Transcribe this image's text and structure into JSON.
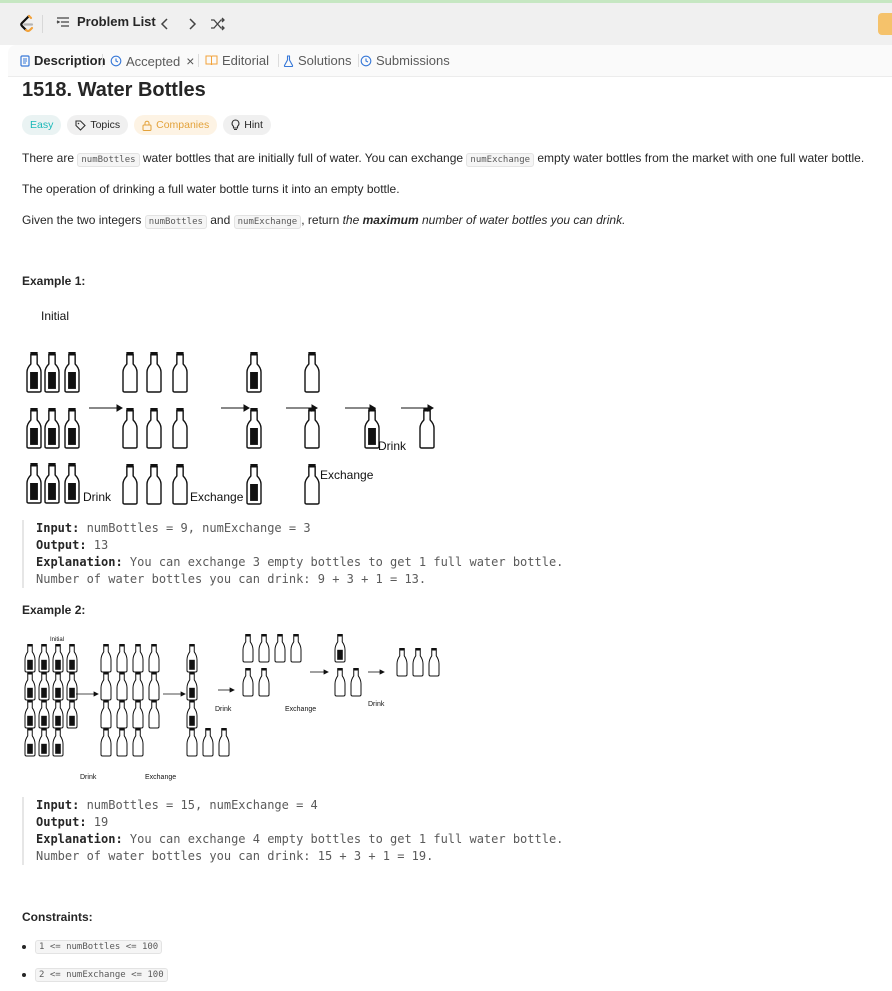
{
  "topbar": {
    "problem_list_label": "Problem List",
    "prev_icon": "chevron-left",
    "next_icon": "chevron-right",
    "shuffle_icon": "shuffle"
  },
  "tabs": [
    {
      "label": "Description",
      "icon": "document-icon"
    },
    {
      "label": "Accepted",
      "icon": "history-icon"
    },
    {
      "label": "Editorial",
      "icon": "book-icon"
    },
    {
      "label": "Solutions",
      "icon": "flask-icon"
    },
    {
      "label": "Submissions",
      "icon": "history-icon"
    }
  ],
  "problem": {
    "title": "1518. Water Bottles",
    "difficulty": "Easy",
    "tags": {
      "topics": "Topics",
      "companies": "Companies",
      "hint": "Hint"
    },
    "desc1": {
      "a": "There are ",
      "code1": "numBottles",
      "b": " water bottles that are initially full of water. You can exchange ",
      "code2": "numExchange",
      "c": " empty water bottles from the market with one full water bottle."
    },
    "desc2": "The operation of drinking a full water bottle turns it into an empty bottle.",
    "desc3": {
      "a": "Given the two integers ",
      "code1": "numBottles",
      "b": " and ",
      "code2": "numExchange",
      "c": ", return ",
      "d": "the ",
      "e": "maximum",
      "f": " number of water bottles you can drink."
    }
  },
  "example1": {
    "heading": "Example 1:",
    "fig": {
      "initial": "Initial",
      "drink1": "Drink",
      "exchange1": "Exchange",
      "exchange2": "Exchange",
      "drink2": "Drink"
    },
    "input_label": "Input:",
    "input": " numBottles = 9, numExchange = 3",
    "output_label": "Output:",
    "output": " 13",
    "expl_label": "Explanation:",
    "expl": " You can exchange 3 empty bottles to get 1 full water bottle.",
    "expl2": "Number of water bottles you can drink: 9 + 3 + 1 = 13."
  },
  "example2": {
    "heading": "Example 2:",
    "fig": {
      "initial": "Initial",
      "drink1": "Drink",
      "exchange1": "Exchange",
      "drink2": "Drink",
      "exchange2": "Exchange",
      "drink3": "Drink"
    },
    "input_label": "Input:",
    "input": " numBottles = 15, numExchange = 4",
    "output_label": "Output:",
    "output": " 19",
    "expl_label": "Explanation:",
    "expl": " You can exchange 4 empty bottles to get 1 full water bottle.",
    "expl2": "Number of water bottles you can drink: 15 + 3 + 1 = 19."
  },
  "constraints": {
    "heading": "Constraints:",
    "items": [
      "1 <= numBottles <= 100",
      "2 <= numExchange <= 100"
    ]
  },
  "colors": {
    "easy": "#1cb8b8",
    "companies": "#e3a23a",
    "bottle": "#111111"
  }
}
